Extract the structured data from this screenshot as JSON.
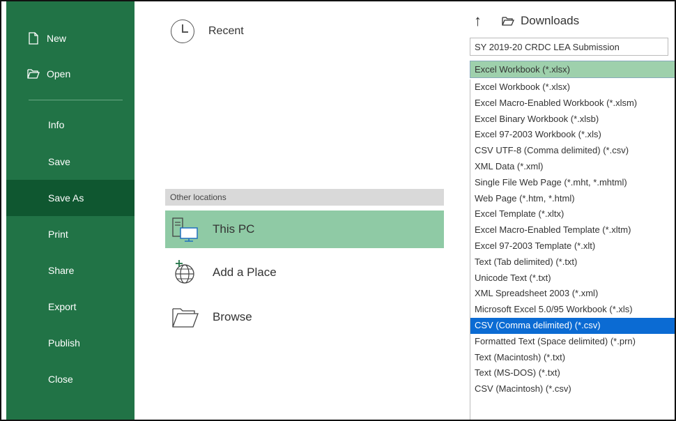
{
  "sidebar": {
    "new_label": "New",
    "open_label": "Open",
    "items": [
      "Info",
      "Save",
      "Save As",
      "Print",
      "Share",
      "Export",
      "Publish",
      "Close"
    ],
    "selected": "Save As"
  },
  "middle": {
    "recent_label": "Recent",
    "other_locations_label": "Other locations",
    "locations": [
      "This PC",
      "Add a Place",
      "Browse"
    ],
    "selected_location": "This PC"
  },
  "right": {
    "current_folder": "Downloads",
    "filename_value": "SY 2019-20 CRDC LEA Submission",
    "selected_type": "Excel Workbook (*.xlsx)",
    "file_types": [
      "Excel Workbook (*.xlsx)",
      "Excel Macro-Enabled Workbook (*.xlsm)",
      "Excel Binary Workbook (*.xlsb)",
      "Excel 97-2003 Workbook (*.xls)",
      "CSV UTF-8 (Comma delimited) (*.csv)",
      "XML Data (*.xml)",
      "Single File Web Page (*.mht, *.mhtml)",
      "Web Page (*.htm, *.html)",
      "Excel Template (*.xltx)",
      "Excel Macro-Enabled Template (*.xltm)",
      "Excel 97-2003 Template (*.xlt)",
      "Text (Tab delimited) (*.txt)",
      "Unicode Text (*.txt)",
      "XML Spreadsheet 2003 (*.xml)",
      "Microsoft Excel 5.0/95 Workbook (*.xls)",
      "CSV (Comma delimited) (*.csv)",
      "Formatted Text (Space delimited) (*.prn)",
      "Text (Macintosh) (*.txt)",
      "Text (MS-DOS) (*.txt)",
      "CSV (Macintosh) (*.csv)"
    ],
    "highlighted_type": "CSV (Comma delimited) (*.csv)"
  },
  "colors": {
    "sidebar_green": "#217346",
    "sidebar_selected": "#0f5730",
    "location_selected": "#8fcaa5",
    "dropdown_highlight": "#0b6bd3"
  },
  "icons": {
    "new": "new-document-icon",
    "open": "open-folder-icon",
    "recent": "clock-icon",
    "this_pc": "computer-icon",
    "add_place": "globe-add-icon",
    "browse": "folder-icon",
    "up": "up-arrow-icon",
    "crumb": "folder-icon"
  }
}
